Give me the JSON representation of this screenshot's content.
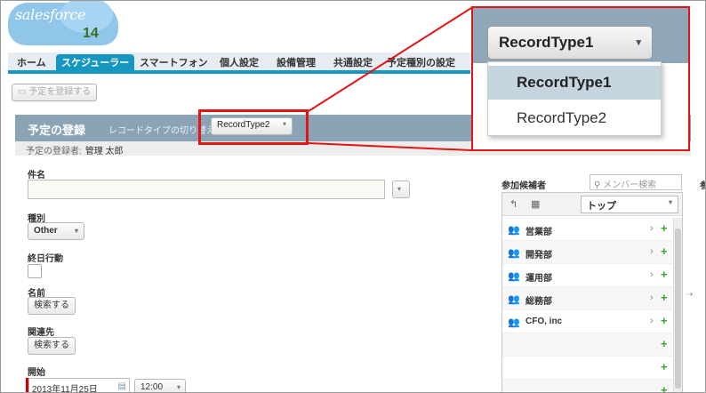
{
  "logo": {
    "brand": "salesforce",
    "version": "14"
  },
  "tabs": [
    "ホーム",
    "スケジューラー",
    "スマートフォン",
    "個人設定",
    "設備管理",
    "共通設定",
    "予定種別の設定"
  ],
  "active_tab": "スケジューラー",
  "toolbar": {
    "register_button": "予定を登録する"
  },
  "section": {
    "title": "予定の登録",
    "recordtype_label": "レコードタイプの切り替え",
    "recordtype_value": "RecordType2"
  },
  "owner": {
    "label": "予定の登録者:",
    "value": "管理 太郎"
  },
  "form": {
    "subject_label": "件名",
    "type_label": "種別",
    "type_value": "Other",
    "allday_label": "終日行動",
    "name_label": "名前",
    "name_button": "検索する",
    "related_label": "関連先",
    "related_button": "検索する",
    "start_label": "開始",
    "start_date": "2013年11月25日",
    "start_time": "12:00"
  },
  "participants": {
    "label": "参加候補者",
    "search_placeholder": "メンバー検索",
    "group_select": "トップ",
    "rows": [
      "営業部",
      "開発部",
      "運用部",
      "総務部",
      "CFO, inc"
    ],
    "right_label": "参"
  },
  "dropdown_zoom": {
    "current": "RecordType1",
    "options": [
      "RecordType1",
      "RecordType2"
    ],
    "highlighted": "RecordType1"
  }
}
